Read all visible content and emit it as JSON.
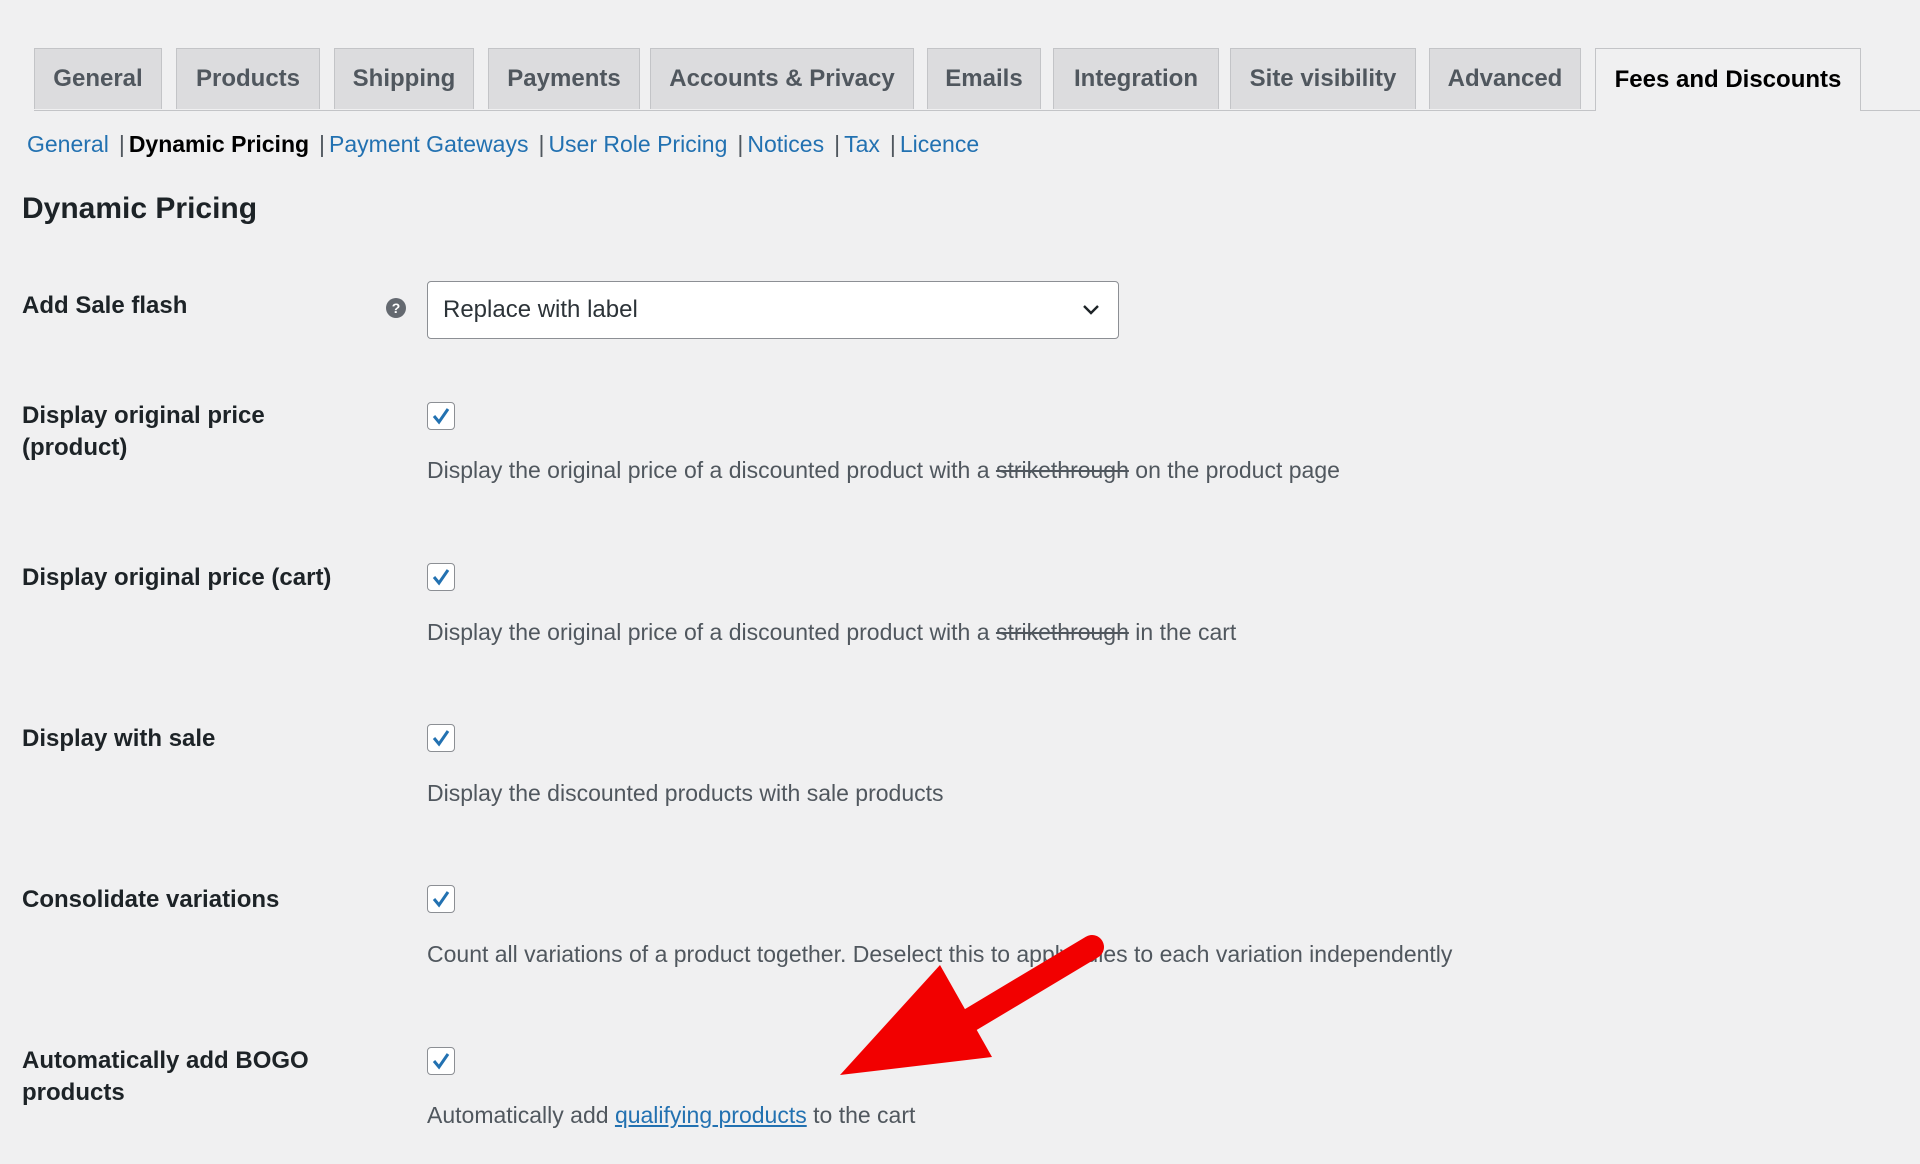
{
  "tabs": [
    {
      "label": "General"
    },
    {
      "label": "Products"
    },
    {
      "label": "Shipping"
    },
    {
      "label": "Payments"
    },
    {
      "label": "Accounts & Privacy"
    },
    {
      "label": "Emails"
    },
    {
      "label": "Integration"
    },
    {
      "label": "Site visibility"
    },
    {
      "label": "Advanced"
    },
    {
      "label": "Fees and Discounts",
      "active": true
    }
  ],
  "subnav": [
    {
      "label": "General"
    },
    {
      "label": "Dynamic Pricing",
      "current": true
    },
    {
      "label": "Payment Gateways"
    },
    {
      "label": "User Role Pricing"
    },
    {
      "label": "Notices"
    },
    {
      "label": "Tax"
    },
    {
      "label": "Licence"
    }
  ],
  "page_title": "Dynamic Pricing",
  "settings": {
    "sale_flash": {
      "label": "Add Sale flash",
      "help_icon": "?",
      "value": "Replace with label"
    },
    "original_price_product": {
      "label_line1": "Display original price",
      "label_line2": "(product)",
      "checked": true,
      "desc_before": "Display the original price of a discounted product with a",
      "desc_strike": "strikethrough",
      "desc_after": "on the product page"
    },
    "original_price_cart": {
      "label": "Display original price (cart)",
      "checked": true,
      "desc_before": "Display the original price of a discounted product with a",
      "desc_strike": "strikethrough",
      "desc_after": "in the cart"
    },
    "display_with_sale": {
      "label": "Display with sale",
      "checked": true,
      "desc": "Display the discounted products with sale products"
    },
    "consolidate_variations": {
      "label": "Consolidate variations",
      "checked": true,
      "desc": "Count all variations of a product together. Deselect this to apply rules to each variation independently"
    },
    "auto_bogo": {
      "label_line1": "Automatically add BOGO",
      "label_line2": "products",
      "checked": true,
      "desc_before": "Automatically add",
      "desc_link": "qualifying products",
      "desc_after": "to the cart"
    }
  },
  "colors": {
    "link": "#2271b1",
    "accent": "#2271b1",
    "annotation_arrow": "#f20000"
  }
}
